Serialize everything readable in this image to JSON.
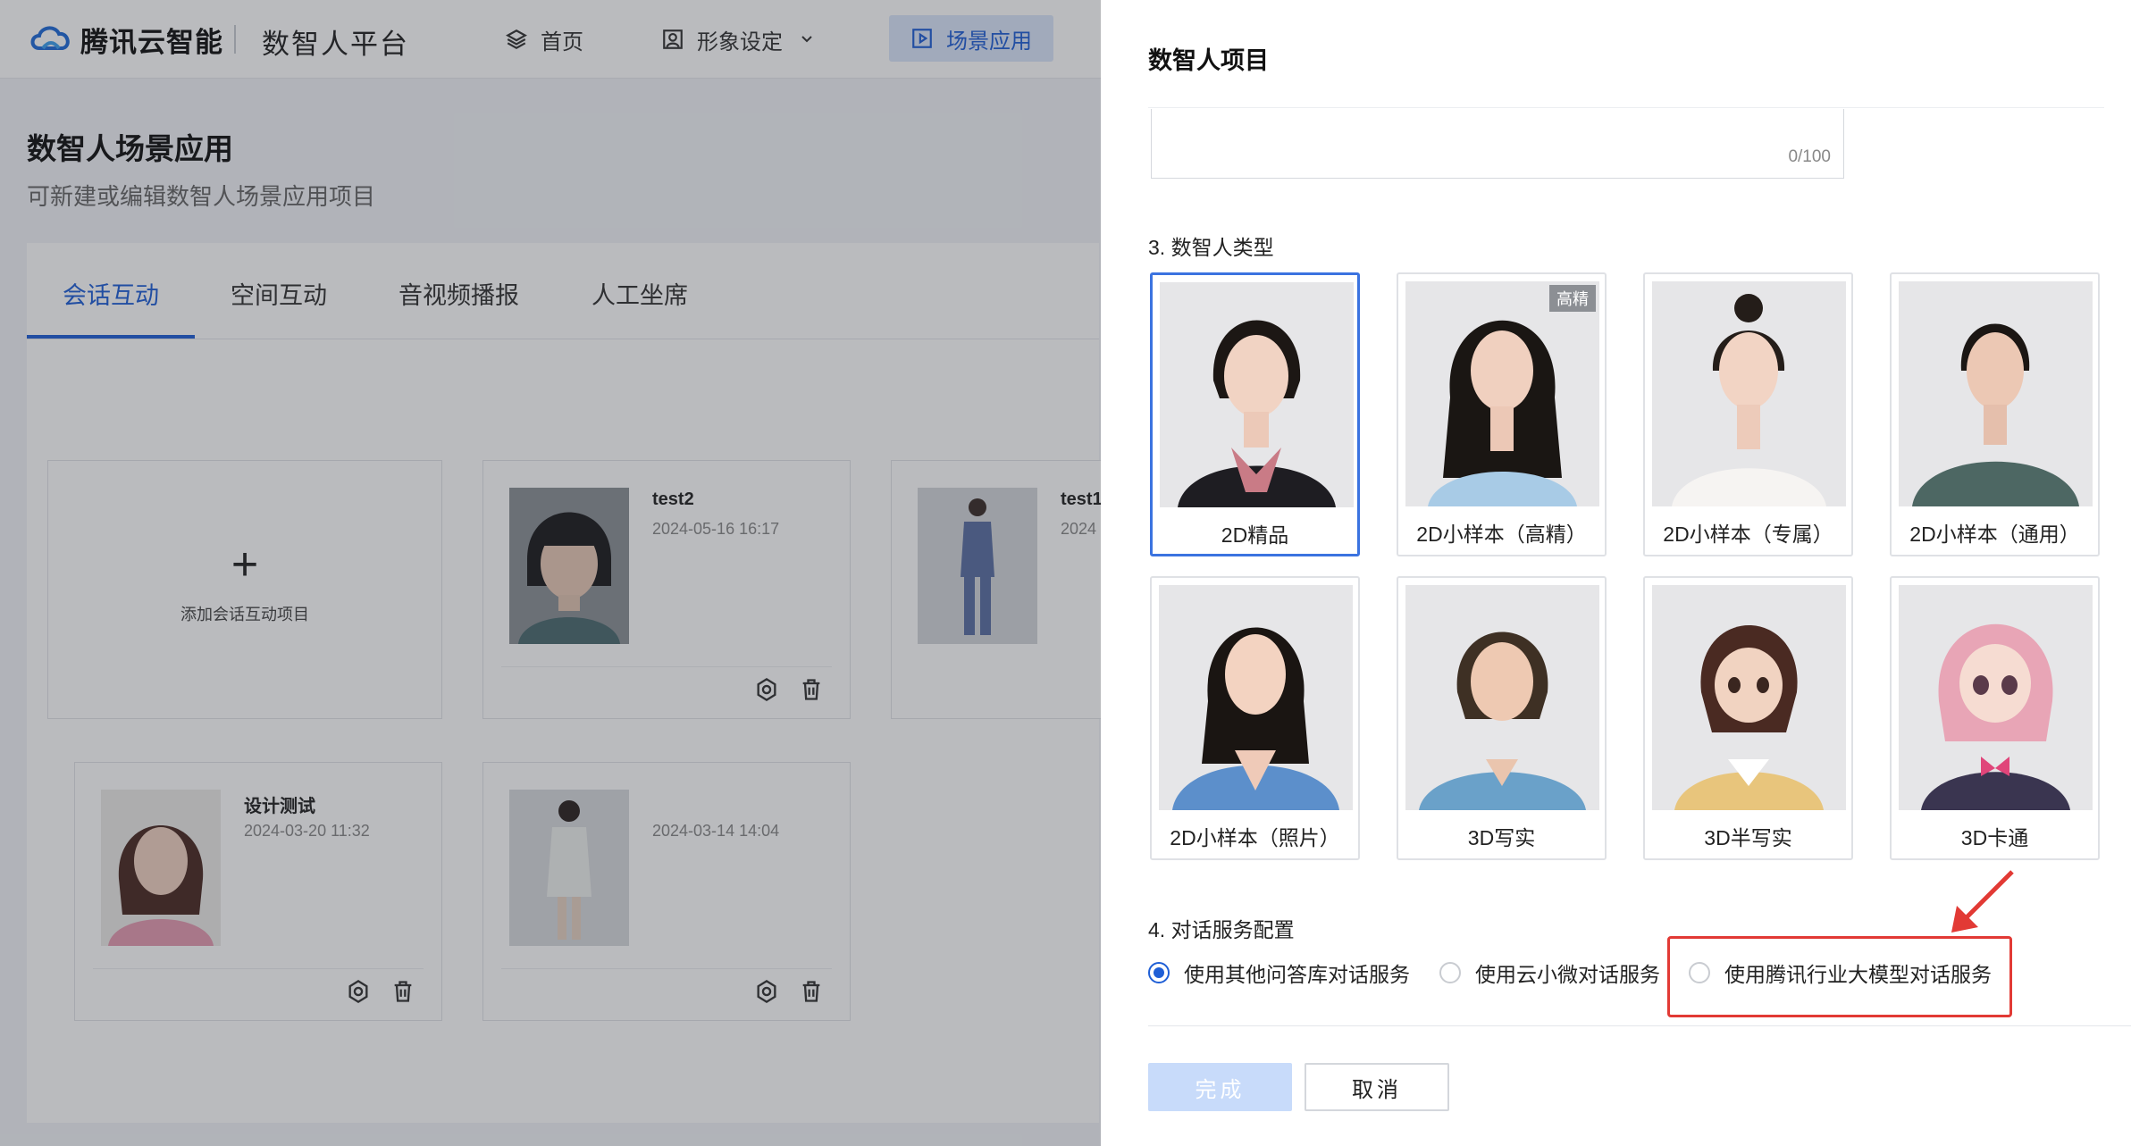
{
  "header": {
    "brand": "腾讯云智能",
    "platform": "数智人平台",
    "nav": [
      {
        "label": "首页",
        "icon": "layers-icon"
      },
      {
        "label": "形象设定",
        "icon": "portrait-icon"
      },
      {
        "label": "场景应用",
        "icon": "play-icon"
      }
    ]
  },
  "page": {
    "title": "数智人场景应用",
    "subtitle": "可新建或编辑数智人场景应用项目"
  },
  "tabs": [
    "会话互动",
    "空间互动",
    "音视频播报",
    "人工坐席"
  ],
  "projects": {
    "add_label": "添加会话互动项目",
    "items": [
      {
        "name": "test2",
        "date": "2024-05-16 16:17"
      },
      {
        "name": "test1",
        "date": "2024"
      },
      {
        "name": "设计测试",
        "date": "2024-03-20 11:32"
      },
      {
        "name": "",
        "date": "2024-03-14 14:04"
      }
    ]
  },
  "drawer": {
    "title": "数智人项目",
    "counter": "0/100",
    "section3": "3. 数智人类型",
    "types": [
      {
        "label": "2D精品",
        "selected": true
      },
      {
        "label": "2D小样本（高精）",
        "badge": "高精"
      },
      {
        "label": "2D小样本（专属）"
      },
      {
        "label": "2D小样本（通用）"
      },
      {
        "label": "2D小样本（照片）"
      },
      {
        "label": "3D写实"
      },
      {
        "label": "3D半写实"
      },
      {
        "label": "3D卡通"
      }
    ],
    "section4": "4. 对话服务配置",
    "services": [
      {
        "label": "使用其他问答库对话服务",
        "checked": true
      },
      {
        "label": "使用云小微对话服务",
        "checked": false
      },
      {
        "label": "使用腾讯行业大模型对话服务",
        "checked": false
      }
    ],
    "ok_label": "完成",
    "cancel_label": "取消"
  },
  "colors": {
    "accent": "#1f5fd6",
    "highlight": "#e23a35",
    "selected_border": "#3b73e0"
  }
}
